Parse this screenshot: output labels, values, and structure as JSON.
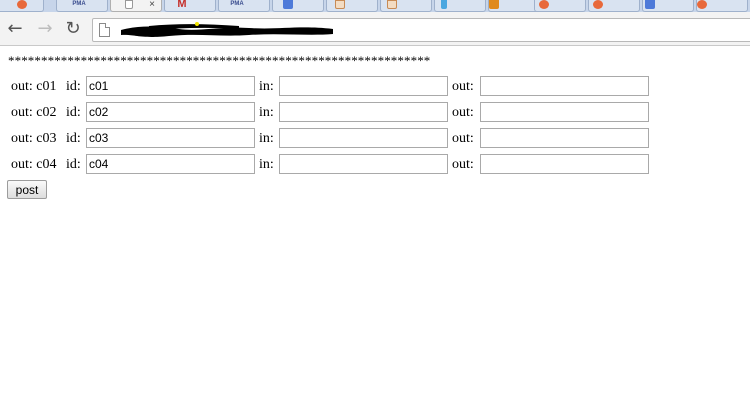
{
  "browser": {
    "tabs": [
      {
        "icon": "gplus-icon",
        "label": ""
      },
      {
        "icon": "phpmyadmin-icon",
        "label": "PMA"
      },
      {
        "icon": "blank-page-icon",
        "label": "",
        "active": true
      },
      {
        "icon": "gmail-icon",
        "label": "M"
      },
      {
        "icon": "phpmyadmin-icon",
        "label": "PMA"
      },
      {
        "icon": "google-icon",
        "label": ""
      },
      {
        "icon": "document-icon",
        "label": ""
      },
      {
        "icon": "document-icon",
        "label": ""
      },
      {
        "icon": "person-icon",
        "label": ""
      },
      {
        "icon": "amazon-icon",
        "label": ""
      },
      {
        "icon": "gplus-icon",
        "label": ""
      },
      {
        "icon": "gplus-icon",
        "label": ""
      },
      {
        "icon": "google-icon",
        "label": ""
      },
      {
        "icon": "gplus-icon",
        "label": ""
      }
    ],
    "close_glyph": "×",
    "back_glyph": "←",
    "forward_glyph": "→",
    "reload_glyph": "↻",
    "url_redacted": true
  },
  "page": {
    "stars": "****************************************************************",
    "rows": [
      {
        "out_prefix": "out: c01",
        "id_label": "id:",
        "id_value": "c01",
        "in_label": "in:",
        "in_value": "",
        "out_label": "out:",
        "out_value": ""
      },
      {
        "out_prefix": "out: c02",
        "id_label": "id:",
        "id_value": "c02",
        "in_label": "in:",
        "in_value": "",
        "out_label": "out:",
        "out_value": ""
      },
      {
        "out_prefix": "out: c03",
        "id_label": "id:",
        "id_value": "c03",
        "in_label": "in:",
        "in_value": "",
        "out_label": "out:",
        "out_value": ""
      },
      {
        "out_prefix": "out: c04",
        "id_label": "id:",
        "id_value": "c04",
        "in_label": "in:",
        "in_value": "",
        "out_label": "out:",
        "out_value": ""
      }
    ],
    "post_label": "post"
  }
}
